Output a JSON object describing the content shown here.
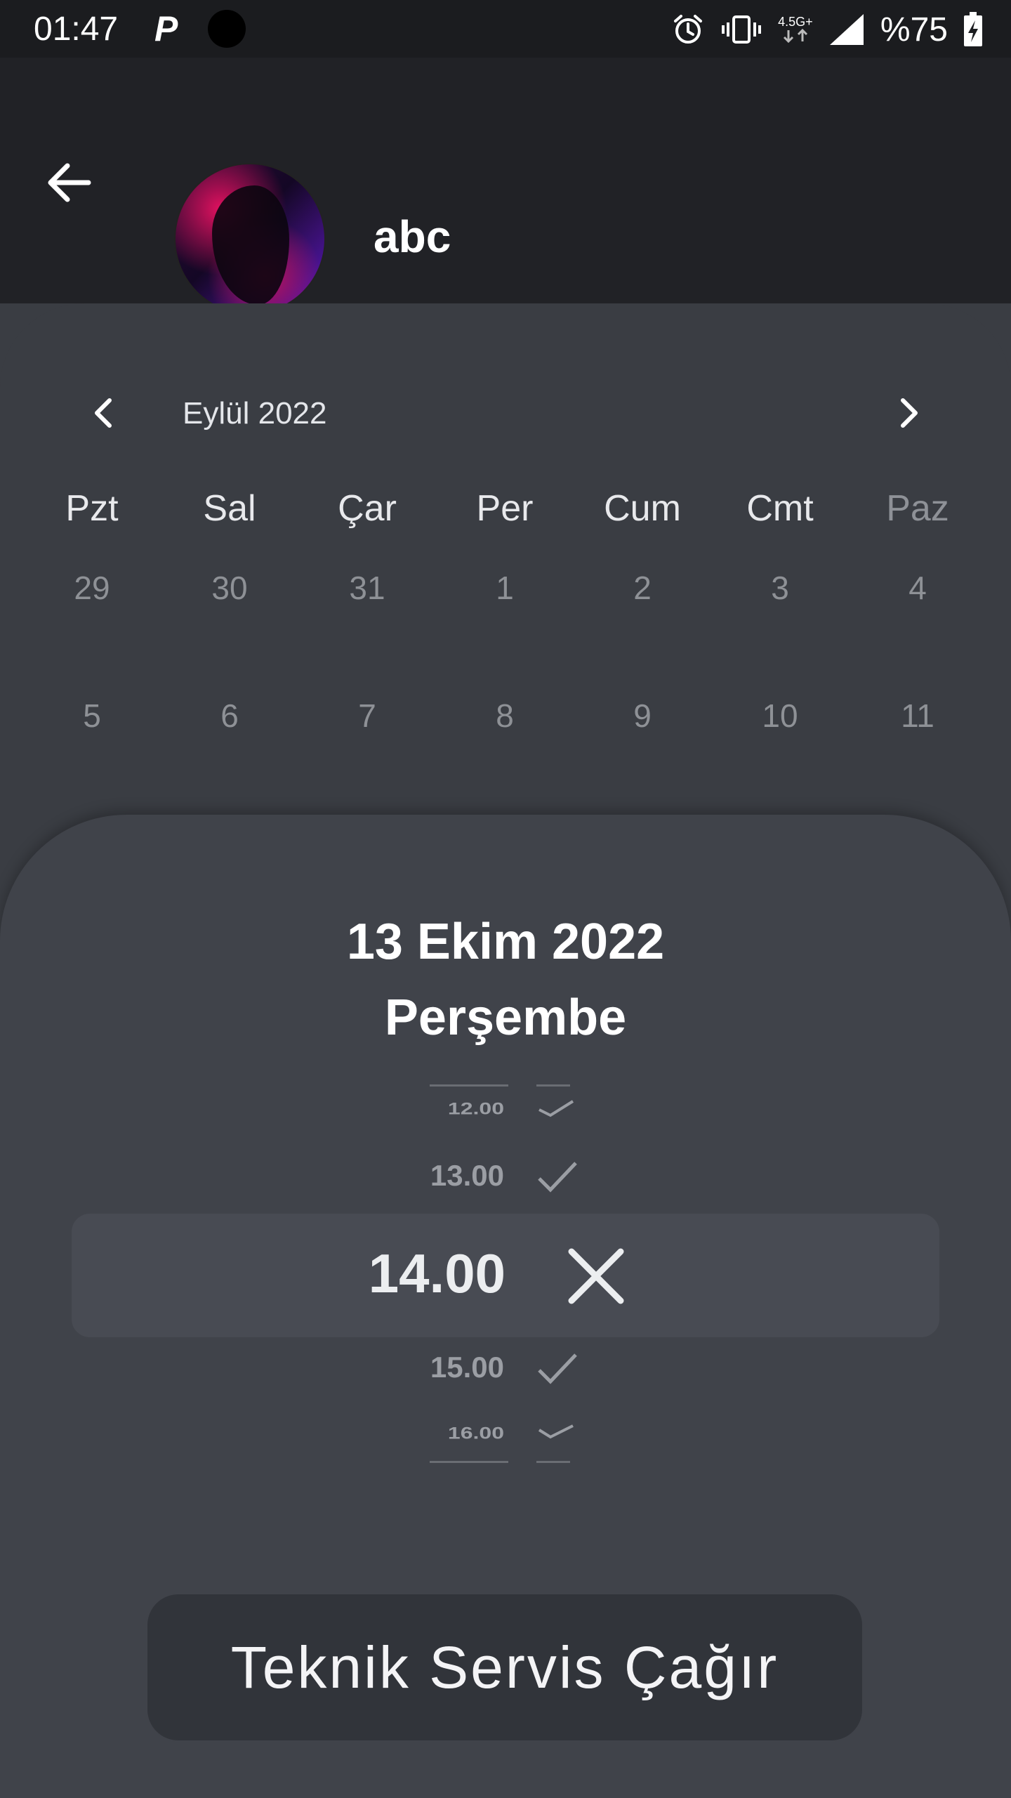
{
  "status_bar": {
    "time": "01:47",
    "app_indicator": "P",
    "network_label": "4.5G+",
    "battery": "%75"
  },
  "header": {
    "user_name": "abc"
  },
  "calendar": {
    "month_label": "Eylül 2022",
    "weekdays": [
      "Pzt",
      "Sal",
      "Çar",
      "Per",
      "Cum",
      "Cmt",
      "Paz"
    ],
    "weeks": [
      [
        "29",
        "30",
        "31",
        "1",
        "2",
        "3",
        "4"
      ],
      [
        "5",
        "6",
        "7",
        "8",
        "9",
        "10",
        "11"
      ]
    ]
  },
  "sheet": {
    "date": "13 Ekim 2022",
    "weekday": "Perşembe",
    "time_slots": [
      {
        "time": "12.00",
        "status": "available"
      },
      {
        "time": "13.00",
        "status": "available"
      },
      {
        "time": "14.00",
        "status": "unavailable",
        "selected": true
      },
      {
        "time": "15.00",
        "status": "available"
      },
      {
        "time": "16.00",
        "status": "available"
      }
    ]
  },
  "actions": {
    "call_service_label": "Teknik Servis Çağır"
  },
  "colors": {
    "background": "#3a3d43",
    "app_bar": "#212226",
    "sheet": "#40434a",
    "selected_band": "#484b53",
    "button": "#31343a"
  }
}
